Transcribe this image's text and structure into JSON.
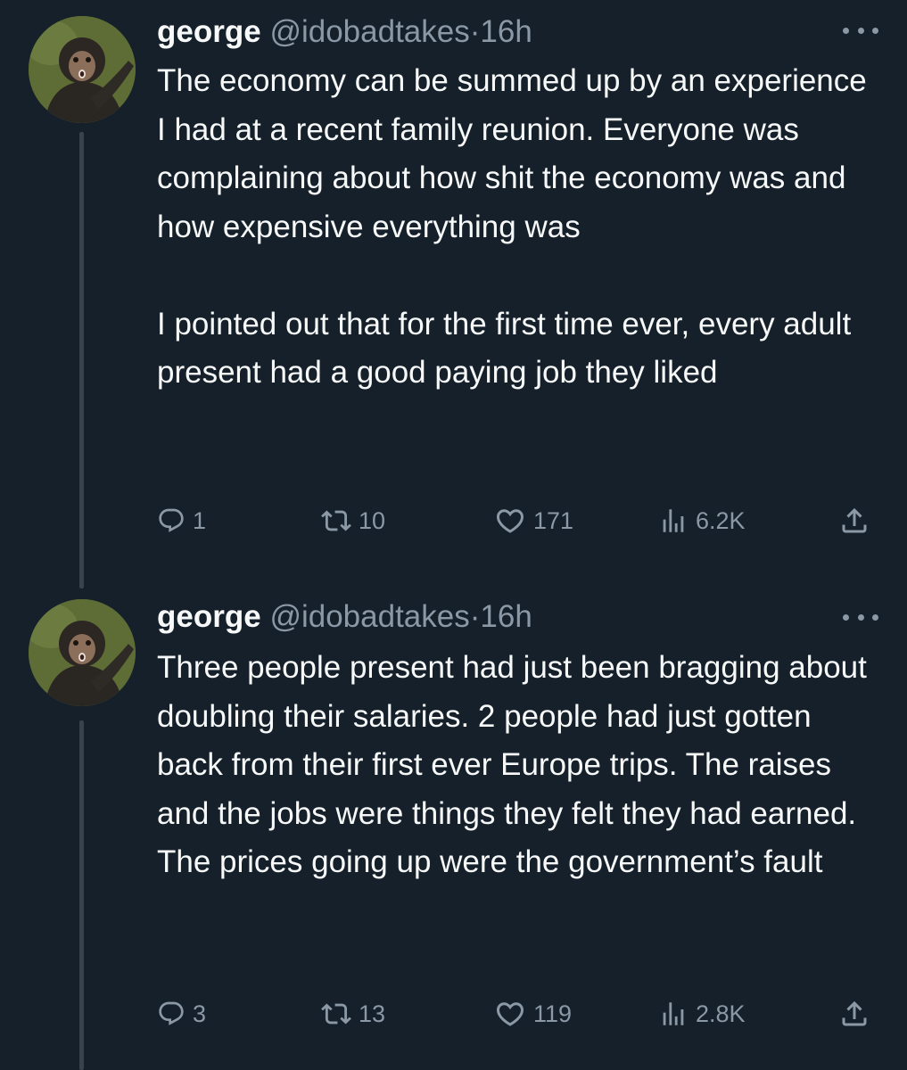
{
  "tweets": [
    {
      "display_name": "george",
      "handle": "@idobadtakes",
      "separator": "·",
      "time": "16h",
      "text": "The economy can be summed up by an experience I had at a recent family reunion. Everyone was complaining about how shit the economy was and how expensive everything was\n\nI pointed out that for the first time ever, every adult present had a good paying job they liked",
      "replies": "1",
      "retweets": "10",
      "likes": "171",
      "views": "6.2K"
    },
    {
      "display_name": "george",
      "handle": "@idobadtakes",
      "separator": "·",
      "time": "16h",
      "text": "Three people present had just been bragging about doubling their salaries. 2 people had just gotten back from their first ever Europe trips. The raises and the jobs were things they felt they had earned. The prices going up were the government’s fault",
      "replies": "3",
      "retweets": "13",
      "likes": "119",
      "views": "2.8K"
    }
  ],
  "icons": {
    "more": "more-horizontal-icon",
    "reply": "reply-icon",
    "retweet": "retweet-icon",
    "like": "heart-icon",
    "views": "views-icon",
    "share": "share-icon"
  },
  "colors": {
    "background": "#15202b",
    "text": "#f7f9f9",
    "secondary": "#8b98a5",
    "thread_line": "#38444d"
  }
}
